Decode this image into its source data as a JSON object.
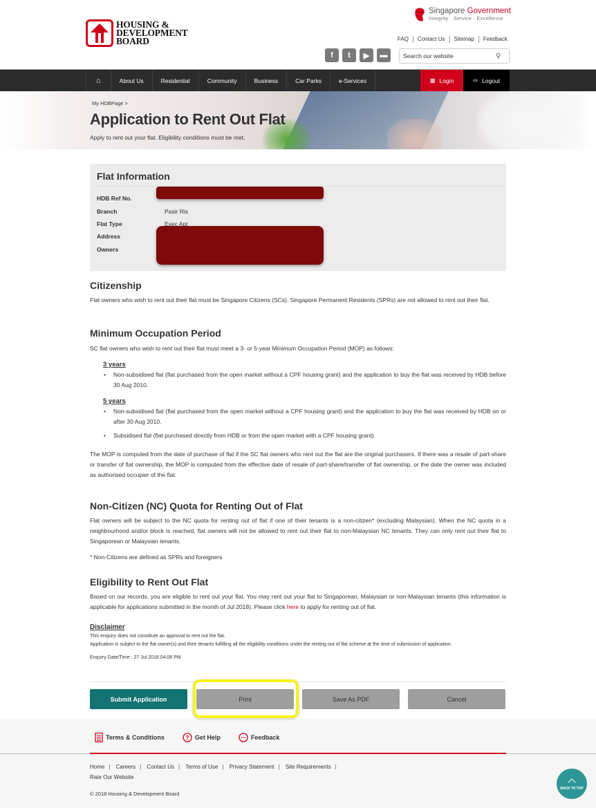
{
  "header": {
    "logo_lines": [
      "HOUSING &",
      "DEVELOPMENT",
      "BOARD"
    ],
    "gov_title_plain": "Singapore ",
    "gov_title_accent": "Government",
    "gov_tagline": "Integrity · Service · Excellence",
    "top_links": [
      "FAQ",
      "Contact Us",
      "Sitemap",
      "Feedback"
    ],
    "social": [
      {
        "icon": "facebook-icon",
        "glyph": "f"
      },
      {
        "icon": "twitter-icon",
        "glyph": "t"
      },
      {
        "icon": "youtube-icon",
        "glyph": "▶"
      },
      {
        "icon": "couch-icon",
        "glyph": "▬"
      }
    ],
    "search_placeholder": "Search our website",
    "search_icon": "⚲"
  },
  "nav": {
    "home_icon": "⌂",
    "items": [
      "About Us",
      "Residential",
      "Community",
      "Business",
      "Car Parks",
      "e-Services"
    ],
    "login_label": "Login",
    "logout_label": "Logout",
    "login_icon": "🔒",
    "logout_icon": "⇨"
  },
  "banner": {
    "breadcrumb": "My HDBPage >",
    "title": "Application to Rent Out Flat",
    "subtitle": "Apply to rent out your flat. Eligibility conditions must be met."
  },
  "flat_info": {
    "title": "Flat Information",
    "rows": [
      {
        "label": "HDB Ref No.",
        "value": ""
      },
      {
        "label": "Branch",
        "value": "Pasir Ris"
      },
      {
        "label": "Flat Type",
        "value": "Exec Apt"
      },
      {
        "label": "Address",
        "value": ""
      },
      {
        "label": "Owners",
        "value": ""
      }
    ]
  },
  "sections": {
    "citizenship": {
      "title": "Citizenship",
      "text": "Flat owners who wish to rent out their flat must be Singapore Citizens (SCs). Singapore Permanent Residents (SPRs) are not allowed to rent out their flat."
    },
    "mop": {
      "title": "Minimum Occupation Period",
      "intro": "SC flat owners who wish to rent out their flat must meet a 3- or 5-year Minimum Occupation Period (MOP) as follows:",
      "three_years_label": "3 years",
      "three_years_items": [
        "Non-subsidised flat (flat purchased from the open market without a CPF housing grant) and the application to buy the flat was received by HDB before 30 Aug 2010."
      ],
      "five_years_label": "5 years",
      "five_years_items": [
        "Non-subsidised flat (flat purchased from the open market without a CPF housing grant) and the application to buy the flat was received by HDB on or after 30 Aug 2010.",
        "Subsidised flat (flat purchased directly from HDB or from the open market with a CPF housing grant)."
      ],
      "note": "The MOP is computed from the date of purchase of flat if the SC flat owners who rent out the flat are the original purchasers. If there was a resale of part-share or transfer of flat ownership, the MOP is computed from the effective date of resale of part-share/transfer of flat ownership, or the date the owner was included as authorised occupier of the flat."
    },
    "nc_quota": {
      "title": "Non-Citizen (NC) Quota for Renting Out of Flat",
      "text": "Flat owners will be subject to the NC quota for renting out of flat if one of their tenants is a non-citizen* (excluding Malaysian). When the NC quota in a neighbourhood and/or block is reached, flat owners will not be allowed to rent out their flat to non-Malaysian NC tenants. They can only rent out their flat to Singaporean or Malaysian tenants.",
      "footnote": "* Non-Citizens are defined as SPRs and foreigners"
    },
    "eligibility": {
      "title": "Eligibility to Rent Out Flat",
      "text_before": "Based on our records, you are eligible to rent out your flat. You may rent out your flat to Singaporean, Malaysian or non-Malaysian tenants (this information is applicable for applications submitted in the month of Jul 2018). Please click ",
      "link": "here",
      "text_after": " to apply for renting out of flat."
    },
    "disclaimer": {
      "title": "Disclaimer",
      "line1": "This enquiry does not constitute an approval to rent out the flat.",
      "line2": "Application is subject to the flat owner(s) and their tenants fulfilling all the eligibility conditions under the renting out of flat scheme at the time of submission of application.",
      "enquiry": "Enquiry Date/Time : 27 Jul 2018 04:08 PM"
    }
  },
  "buttons": {
    "submit": "Submit Application",
    "print": "Print",
    "save_pdf": "Save As PDF",
    "cancel": "Cancel"
  },
  "footer": {
    "quick_links": [
      {
        "label": "Terms & Conditions",
        "icon": "▤"
      },
      {
        "label": "Get Help",
        "icon": "?"
      },
      {
        "label": "Feedback",
        "icon": "…"
      }
    ],
    "links": [
      "Home",
      "Careers",
      "Contact Us",
      "Terms of Use",
      "Privacy Statement",
      "Site Requirements",
      "Rate Our Website"
    ],
    "copyright": "© 2018 Housing & Development Board",
    "back_to_top": "BACK TO TOP"
  },
  "colors": {
    "brand_red": "#d0021b",
    "submit_teal": "#137272",
    "nav_dark": "#2b2b2b",
    "highlight_yellow": "#f7f21a"
  }
}
